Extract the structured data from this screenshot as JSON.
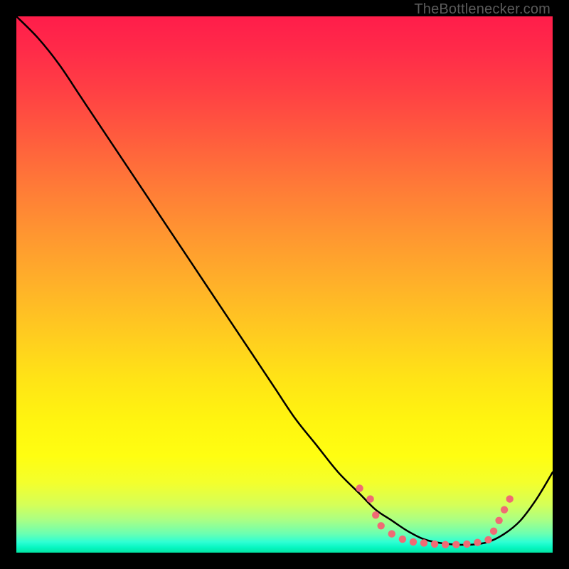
{
  "attribution": "TheBottlenecker.com",
  "colors": {
    "frame": "#000000",
    "curve": "#000000",
    "dots": "#f06a74",
    "gradient_top": "#ff1d4a",
    "gradient_bottom": "#03e4a2"
  },
  "chart_data": {
    "type": "line",
    "title": "",
    "xlabel": "",
    "ylabel": "",
    "xlim": [
      0,
      100
    ],
    "ylim": [
      0,
      100
    ],
    "grid": false,
    "legend": false,
    "series": [
      {
        "name": "curve",
        "x": [
          0,
          4,
          8,
          12,
          16,
          20,
          24,
          28,
          32,
          36,
          40,
          44,
          48,
          52,
          56,
          60,
          64,
          67,
          70,
          73,
          76,
          79,
          82,
          85,
          88,
          91,
          94,
          97,
          100
        ],
        "y": [
          100,
          96,
          91,
          85,
          79,
          73,
          67,
          61,
          55,
          49,
          43,
          37,
          31,
          25,
          20,
          15,
          11,
          8,
          6,
          4,
          2.5,
          1.8,
          1.5,
          1.5,
          2,
          3.5,
          6,
          10,
          15
        ]
      }
    ],
    "dots": [
      {
        "x": 64,
        "y": 12
      },
      {
        "x": 66,
        "y": 10
      },
      {
        "x": 67,
        "y": 7
      },
      {
        "x": 68,
        "y": 5
      },
      {
        "x": 70,
        "y": 3.5
      },
      {
        "x": 72,
        "y": 2.5
      },
      {
        "x": 74,
        "y": 2
      },
      {
        "x": 76,
        "y": 1.8
      },
      {
        "x": 78,
        "y": 1.6
      },
      {
        "x": 80,
        "y": 1.5
      },
      {
        "x": 82,
        "y": 1.5
      },
      {
        "x": 84,
        "y": 1.6
      },
      {
        "x": 86,
        "y": 1.9
      },
      {
        "x": 88,
        "y": 2.4
      },
      {
        "x": 89,
        "y": 4
      },
      {
        "x": 90,
        "y": 6
      },
      {
        "x": 91,
        "y": 8
      },
      {
        "x": 92,
        "y": 10
      }
    ]
  }
}
